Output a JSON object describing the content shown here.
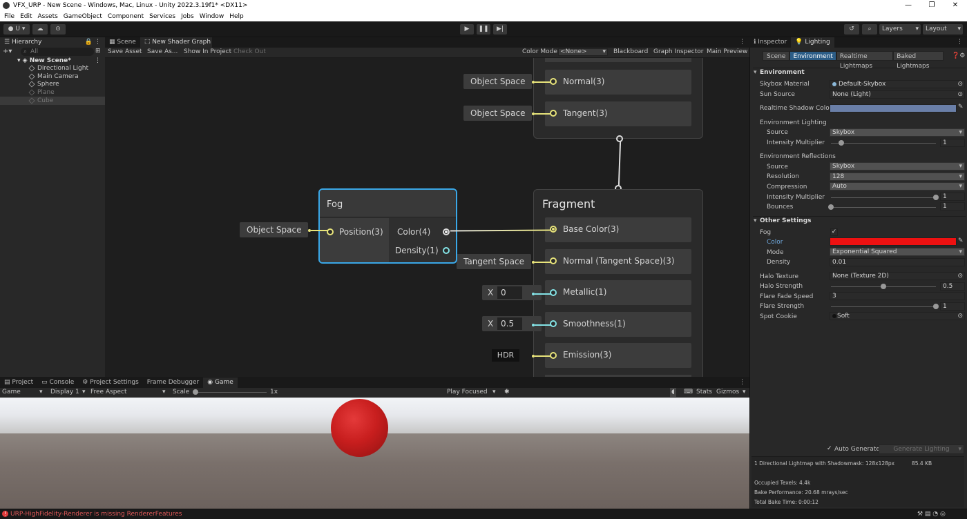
{
  "window": {
    "title": "VFX_URP - New Scene - Windows, Mac, Linux - Unity 2022.3.19f1* <DX11>"
  },
  "menu": [
    "File",
    "Edit",
    "Assets",
    "GameObject",
    "Component",
    "Services",
    "Jobs",
    "Window",
    "Help"
  ],
  "toolbar": {
    "account": "U",
    "layers": "Layers",
    "layout": "Layout"
  },
  "hierarchy": {
    "tab": "Hierarchy",
    "search_placeholder": "All",
    "scene": "New Scene*",
    "items": [
      "Directional Light",
      "Main Camera",
      "Sphere",
      "Plane",
      "Cube"
    ]
  },
  "center_tabs": [
    "Scene",
    "New Shader Graph"
  ],
  "shader_toolbar": {
    "save_asset": "Save Asset",
    "save_as": "Save As...",
    "show_in_project": "Show In Project",
    "check_out": "Check Out",
    "color_mode_label": "Color Mode",
    "color_mode_value": "<None>",
    "blackboard": "Blackboard",
    "graph_inspector": "Graph Inspector",
    "main_preview": "Main Preview"
  },
  "graph": {
    "vertex_slots": [
      "Normal(3)",
      "Tangent(3)"
    ],
    "vertex_inputs": [
      "Object Space",
      "Object Space"
    ],
    "fog_node": {
      "title": "Fog",
      "input": "Position(3)",
      "input_source": "Object Space",
      "out_color": "Color(4)",
      "out_density": "Density(1)"
    },
    "fragment": {
      "title": "Fragment",
      "slots": [
        "Base Color(3)",
        "Normal (Tangent Space)(3)",
        "Metallic(1)",
        "Smoothness(1)",
        "Emission(3)"
      ],
      "normal_input": "Tangent Space",
      "metallic_axis": "X",
      "metallic_value": "0",
      "smooth_axis": "X",
      "smooth_value": "0.5",
      "emission_input": "HDR"
    }
  },
  "bottom_tabs": [
    "Project",
    "Console",
    "Project Settings",
    "Frame Debugger",
    "Game"
  ],
  "game_bar": {
    "mode": "Game",
    "display": "Display 1",
    "aspect": "Free Aspect",
    "scale_label": "Scale",
    "scale_value": "1x",
    "play_focused": "Play Focused",
    "stats": "Stats",
    "gizmos": "Gizmos"
  },
  "status": {
    "error": "URP-HighFidelity-Renderer is missing RendererFeatures"
  },
  "right_tabs": [
    "Inspector",
    "Lighting"
  ],
  "lighting_tabs": [
    "Scene",
    "Environment",
    "Realtime Lightmaps",
    "Baked Lightmaps"
  ],
  "environment": {
    "header": "Environment",
    "skybox_material_label": "Skybox Material",
    "skybox_material": "Default-Skybox",
    "sun_source_label": "Sun Source",
    "sun_source": "None (Light)",
    "shadow_color_label": "Realtime Shadow Color",
    "shadow_color": "#6a7fa8",
    "env_lighting": "Environment Lighting",
    "source_label": "Source",
    "source": "Skybox",
    "intensity_label": "Intensity Multiplier",
    "intensity": "1",
    "intensity_frac": 0.1,
    "env_reflections": "Environment Reflections",
    "refl_source": "Skybox",
    "resolution_label": "Resolution",
    "resolution": "128",
    "compression_label": "Compression",
    "compression": "Auto",
    "refl_intensity": "1",
    "refl_intensity_frac": 1.0,
    "bounces_label": "Bounces",
    "bounces": "1",
    "bounces_frac": 0.0
  },
  "other": {
    "header": "Other Settings",
    "fog_label": "Fog",
    "color_label": "Color",
    "fog_color": "#ee1111",
    "mode_label": "Mode",
    "mode": "Exponential Squared",
    "density_label": "Density",
    "density": "0.01",
    "halo_texture_label": "Halo Texture",
    "halo_texture": "None (Texture 2D)",
    "halo_strength_label": "Halo Strength",
    "halo_strength": "0.5",
    "halo_strength_frac": 0.5,
    "flare_fade_label": "Flare Fade Speed",
    "flare_fade": "3",
    "flare_strength_label": "Flare Strength",
    "flare_strength": "1",
    "flare_strength_frac": 1.0,
    "spot_cookie_label": "Spot Cookie",
    "spot_cookie": "Soft"
  },
  "bake": {
    "auto_generate": "Auto Generate",
    "generate": "Generate Lighting",
    "summary": "1 Directional Lightmap with Shadowmask: 128x128px",
    "size": "85.4 KB",
    "texels": "Occupied Texels: 4.4k",
    "performance": "Bake Performance: 20.68 mrays/sec",
    "total_time": "Total Bake Time: 0:00:12"
  },
  "colors": {
    "accent": "#2c5d87",
    "fog_node_border": "#3aa8e8",
    "port_yellow": "#e8e47b",
    "port_blue": "#84e4e7",
    "sphere": "#c81e1e"
  }
}
